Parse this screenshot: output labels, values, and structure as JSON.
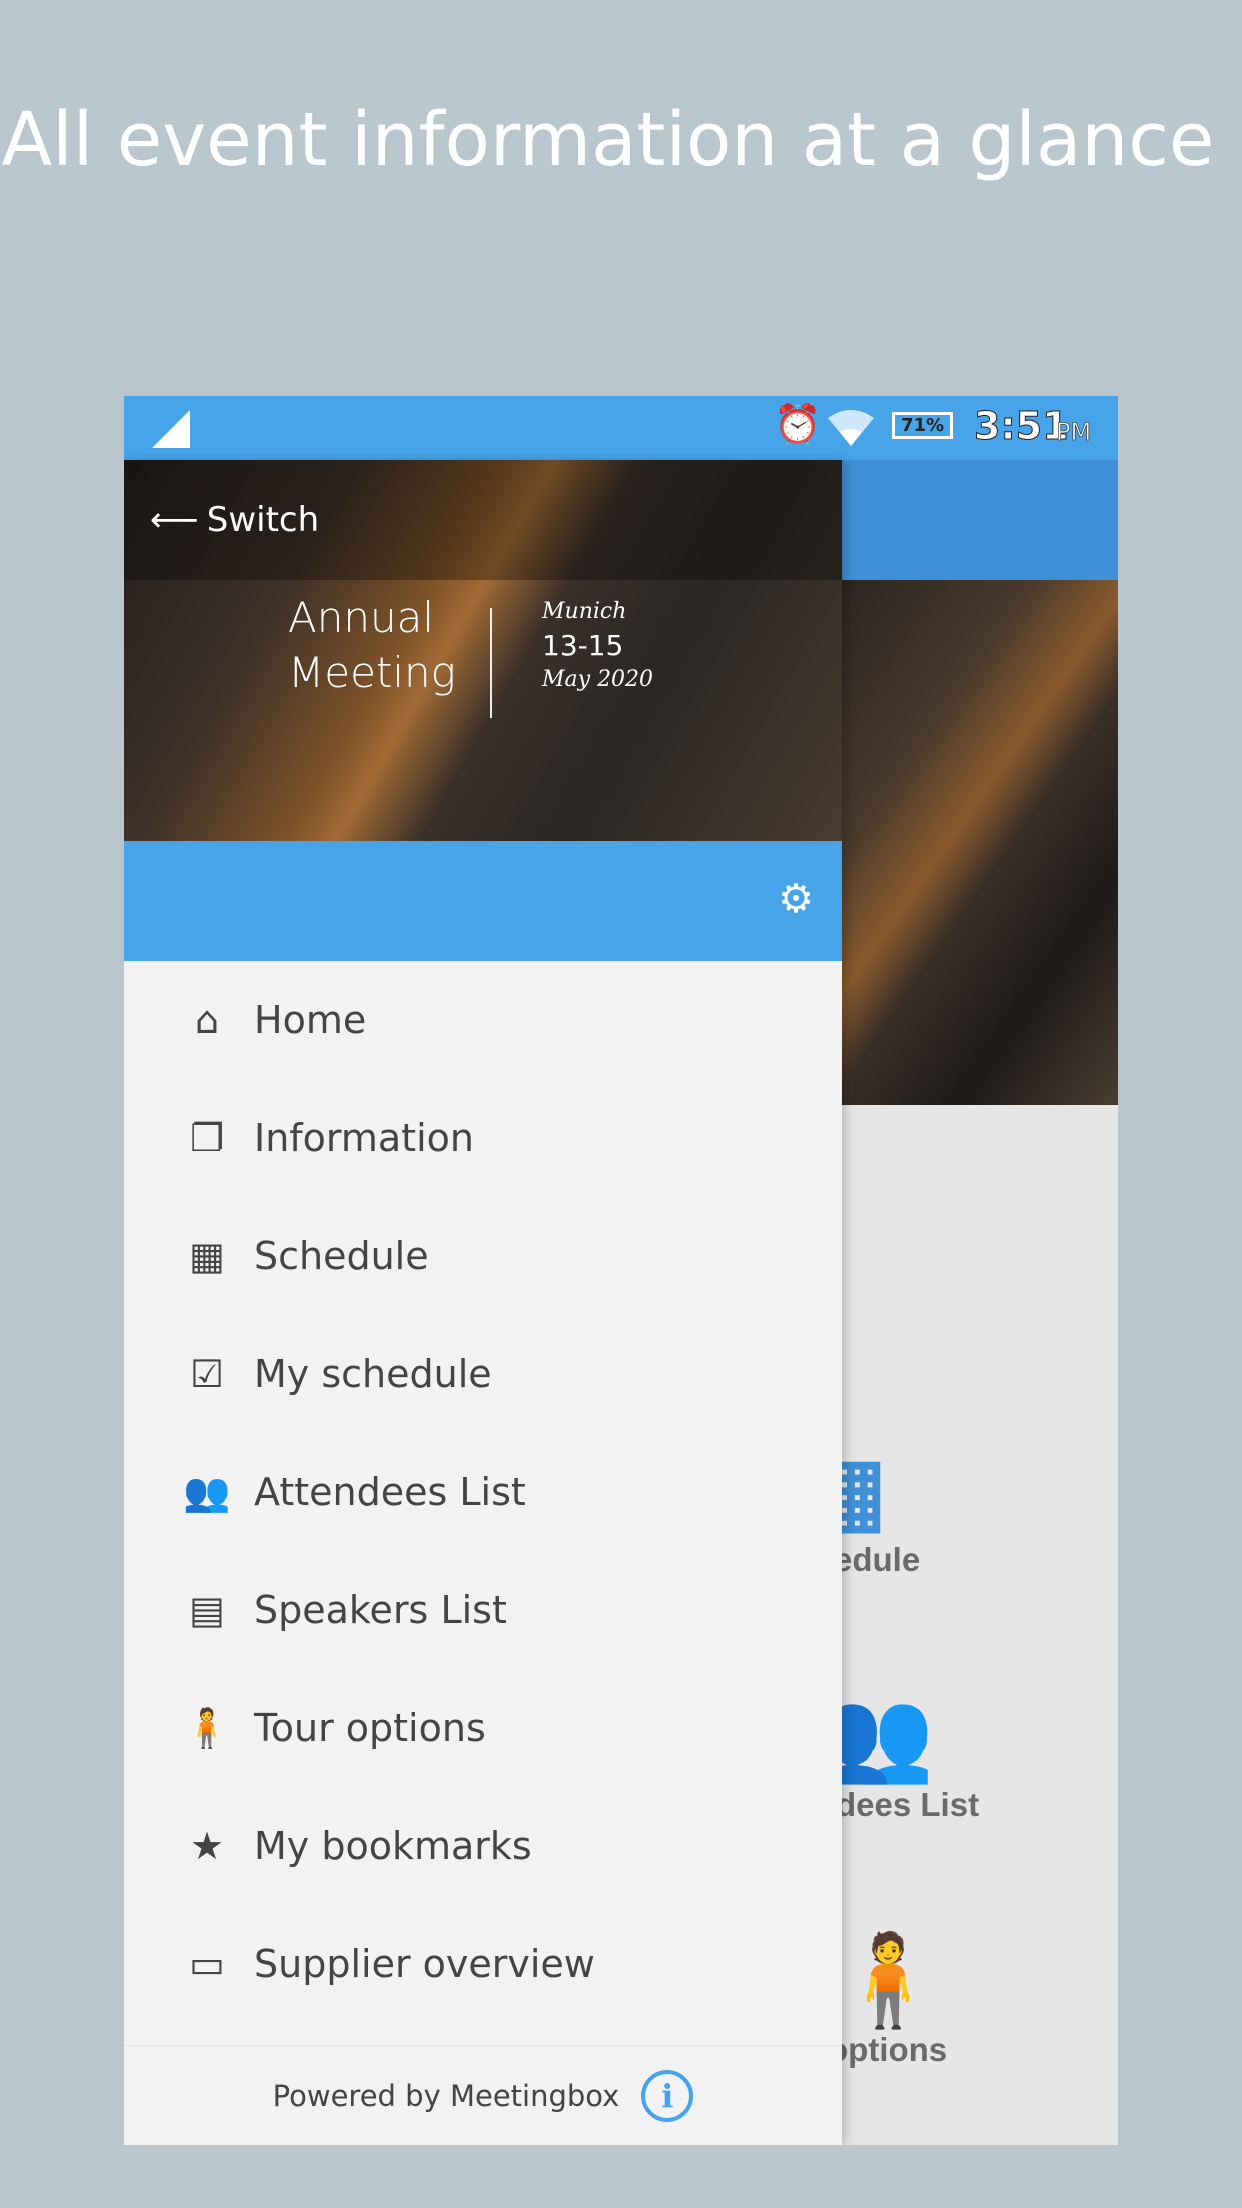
{
  "headline": "All event information at a glance",
  "status_bar": {
    "battery": "71%",
    "time": "3:51",
    "ampm": "PM",
    "icons": [
      "signal-icon",
      "alarm-icon",
      "wifi-icon",
      "battery-icon"
    ]
  },
  "drawer": {
    "switch_label": "Switch",
    "event": {
      "title_line1": "Annual",
      "title_line2": "Meeting",
      "city": "Munich",
      "dates": "13-15",
      "month_year": "May 2020"
    },
    "menu": [
      {
        "label": "Home",
        "icon": "home-icon"
      },
      {
        "label": "Information",
        "icon": "copy-icon"
      },
      {
        "label": "Schedule",
        "icon": "calendar-icon"
      },
      {
        "label": "My schedule",
        "icon": "calendar-check-icon"
      },
      {
        "label": "Attendees List",
        "icon": "users-icon"
      },
      {
        "label": "Speakers List",
        "icon": "address-book-icon"
      },
      {
        "label": "Tour options",
        "icon": "child-icon"
      },
      {
        "label": "My bookmarks",
        "icon": "star-icon"
      },
      {
        "label": "Supplier overview",
        "icon": "id-card-icon"
      }
    ],
    "footer": "Powered by Meetingbox"
  },
  "background_tiles": [
    {
      "label": "edule"
    },
    {
      "label": "dees List"
    },
    {
      "label": "options"
    }
  ],
  "colors": {
    "accent": "#47a4e8",
    "appbar": "#3f90d6",
    "page_bg": "#b9c6ce"
  }
}
